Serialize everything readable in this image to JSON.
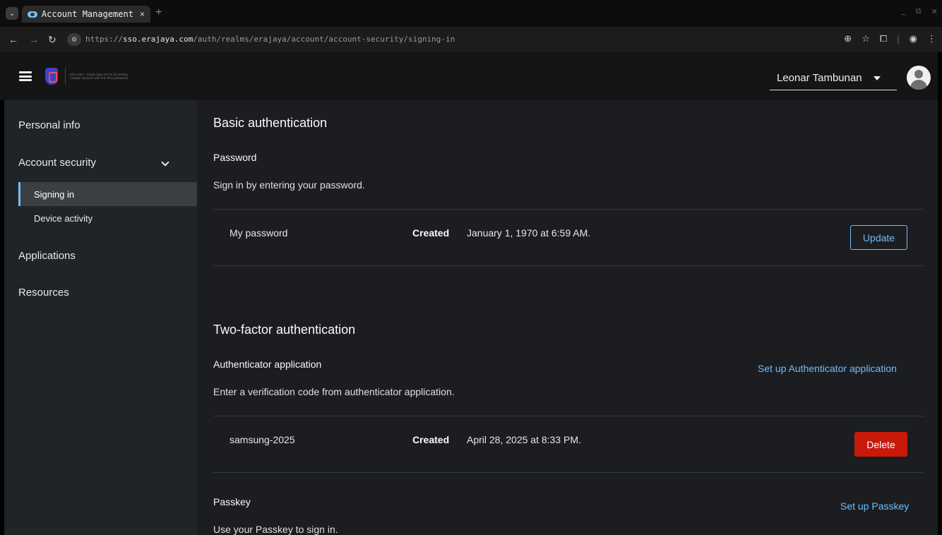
{
  "browser": {
    "tab_title": "Account Management",
    "tab_close": "×",
    "new_tab": "+",
    "url_scheme": "https://",
    "url_host": "sso.erajaya.com",
    "url_path": "/auth/realms/erajaya/account/account-security/signing-in"
  },
  "header": {
    "brand_text": "ERA SSO - Single Sign-On for accessing multiple systems with one ID & password",
    "user_name": "Leonar Tambunan"
  },
  "sidebar": {
    "items": [
      {
        "label": "Personal info"
      },
      {
        "label": "Account security"
      },
      {
        "label": "Applications"
      },
      {
        "label": "Resources"
      }
    ],
    "sub_items": [
      {
        "label": "Signing in"
      },
      {
        "label": "Device activity"
      }
    ]
  },
  "basic_auth": {
    "title": "Basic authentication",
    "password": {
      "title": "Password",
      "description": "Sign in by entering your password.",
      "credential_name": "My password",
      "created_label": "Created",
      "created_date": "January 1, 1970 at 6:59 AM.",
      "update_label": "Update"
    }
  },
  "two_factor": {
    "title": "Two-factor authentication",
    "authenticator": {
      "title": "Authenticator application",
      "setup_link": "Set up Authenticator application",
      "description": "Enter a verification code from authenticator application.",
      "credential_name": "samsung-2025",
      "created_label": "Created",
      "created_date": "April 28, 2025 at 8:33 PM.",
      "delete_label": "Delete"
    },
    "passkey": {
      "title": "Passkey",
      "setup_link": "Set up Passkey",
      "description": "Use your Passkey to sign in."
    }
  },
  "colors": {
    "link": "#73bcf7",
    "danger": "#c9190b",
    "sidebar_bg": "#212427",
    "content_bg": "#1b1d21"
  }
}
